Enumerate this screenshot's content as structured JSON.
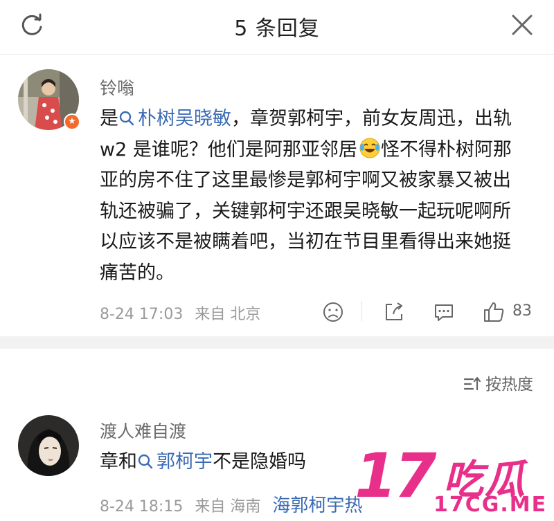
{
  "header": {
    "title": "5 条回复",
    "refresh_icon": "refresh-icon",
    "close_icon": "close-icon"
  },
  "comments": [
    {
      "username": "铃嗡",
      "text_pre": "是",
      "tag": "朴树吴晓敏",
      "text_post": "，章贺郭柯宇，前女友周迅，出轨 w2 是谁呢？他们是阿那亚邻居",
      "emoji": "laughing-tears-emoji",
      "text_rest": "怪不得朴树阿那亚的房不住了这里最惨是郭柯宇啊又被家暴又被出轨还被骗了，关键郭柯宇还跟吴晓敏一起玩呢啊所以应该不是被瞒着吧，当初在节目里看得出来她挺痛苦的。",
      "date": "8-24 17:03",
      "source": "来自 北京",
      "likes": "83"
    },
    {
      "username": "渡人难自渡",
      "text_pre": "章和",
      "tag": "郭柯宇",
      "text_post": "不是隐婚吗",
      "date": "8-24 18:15",
      "source": "来自 海南",
      "extra_tag": "海郭柯宇热"
    }
  ],
  "sort_label": "按热度",
  "watermark": {
    "number": "17",
    "text": "吃瓜",
    "url": "17CG.ME"
  },
  "colors": {
    "link": "#3b6bb5",
    "watermark": "#e8308a",
    "badge": "#f5692a"
  }
}
